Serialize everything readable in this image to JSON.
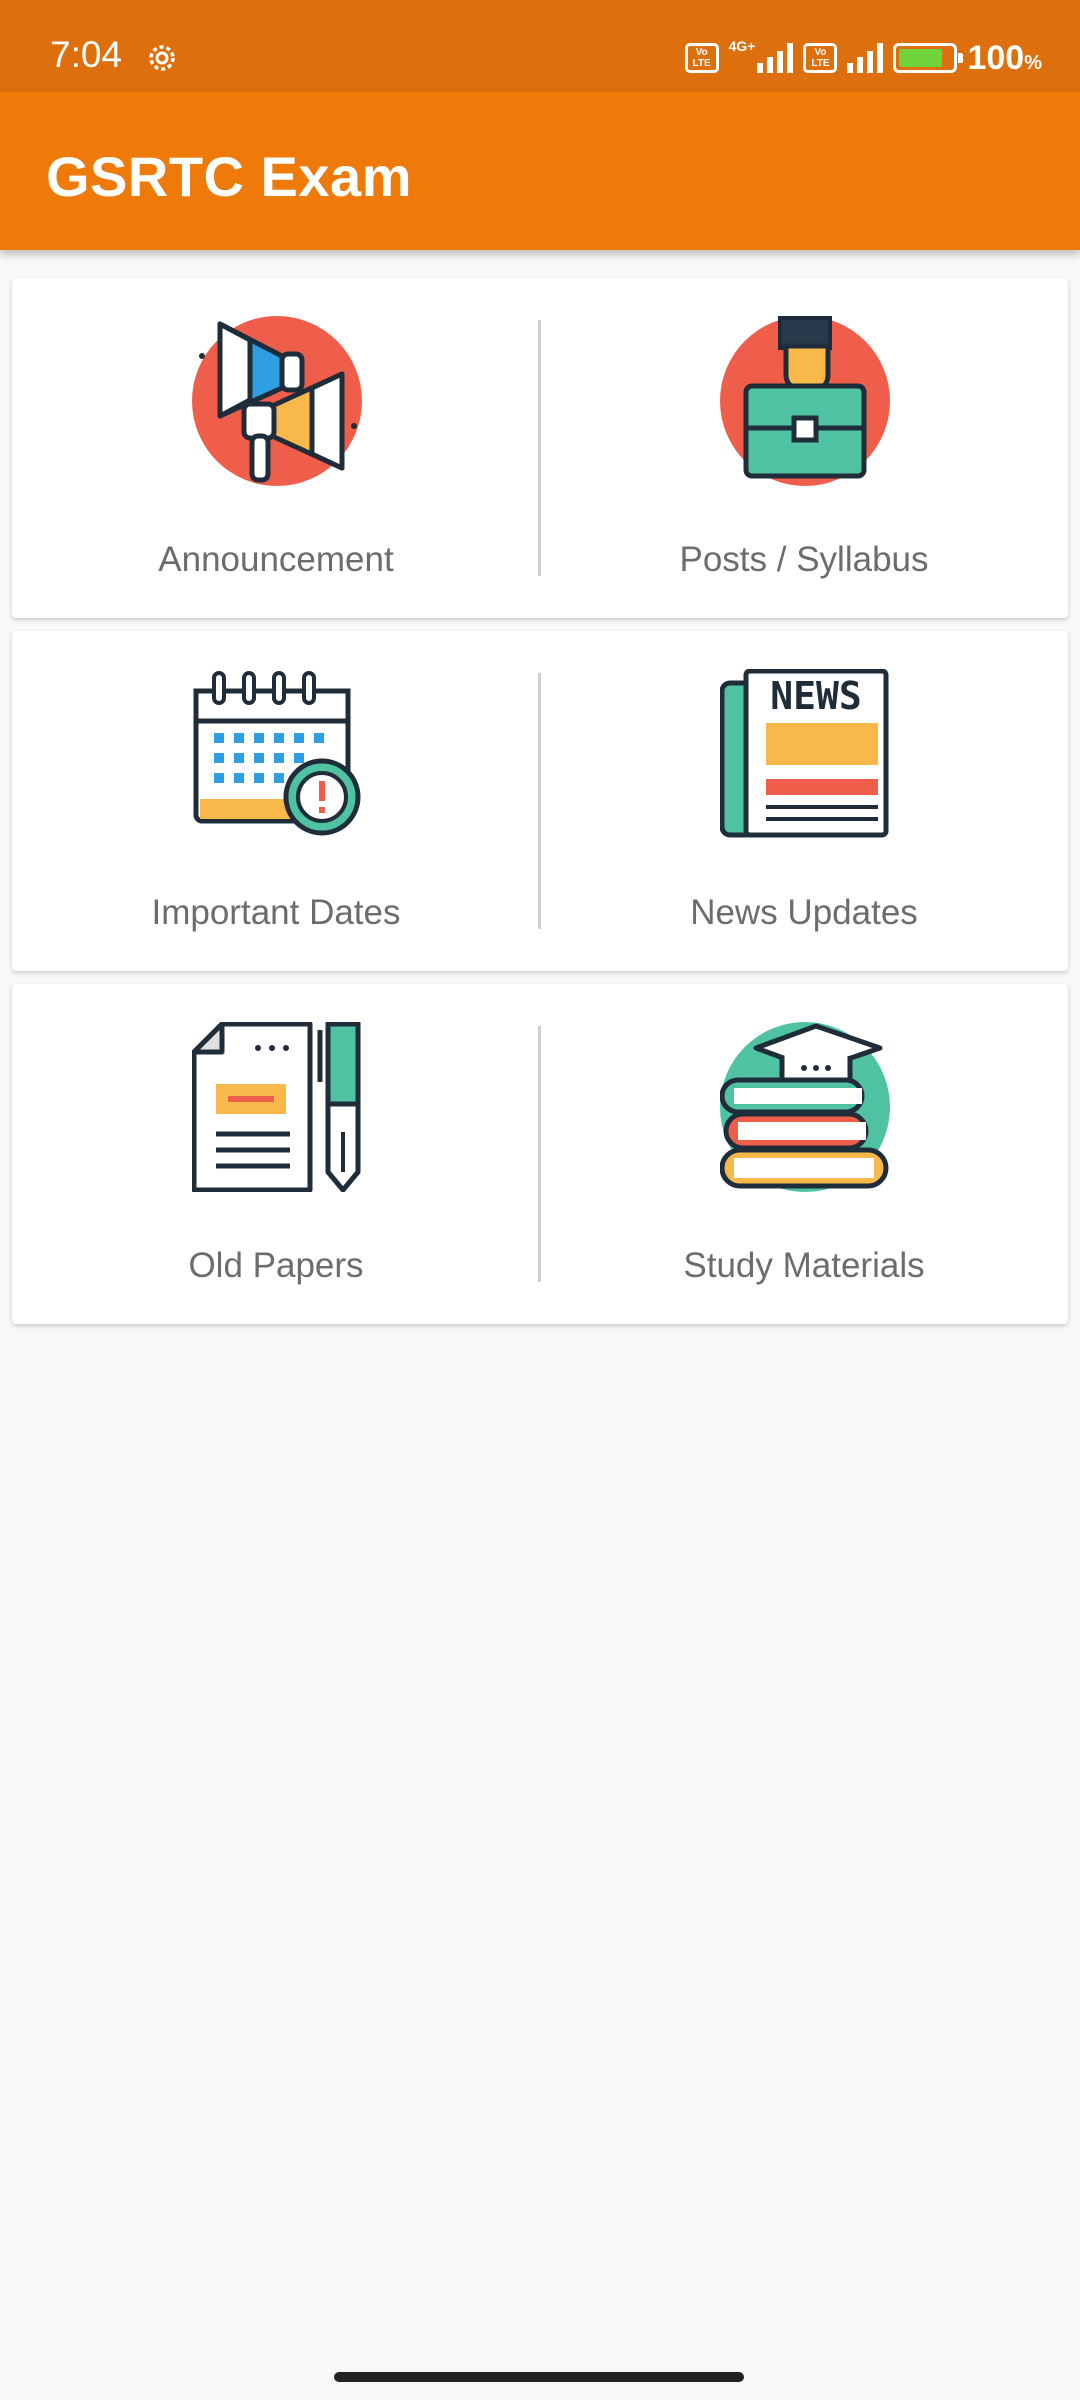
{
  "status_bar": {
    "time": "7:04",
    "network_type": "4G+",
    "volte_label_1": "Vo\nLTE",
    "volte_label_2": "Vo\nLTE",
    "battery_percent": "100",
    "battery_unit": "%",
    "icons": [
      "settings-gear-icon",
      "volte-icon",
      "signal-icon",
      "volte-icon",
      "signal-icon",
      "battery-charging-icon"
    ]
  },
  "app_bar": {
    "title": "GSRTC Exam",
    "color": "#ee7a0a"
  },
  "menu": [
    {
      "label": "Announcement",
      "icon": "megaphone-icon"
    },
    {
      "label": "Posts / Syllabus",
      "icon": "briefcase-icon"
    },
    {
      "label": "Important Dates",
      "icon": "calendar-icon"
    },
    {
      "label": "News Updates",
      "icon": "newspaper-icon"
    },
    {
      "label": "Old Papers",
      "icon": "document-pen-icon"
    },
    {
      "label": "Study Materials",
      "icon": "books-graduation-icon"
    }
  ],
  "news_icon_text": "NEWS"
}
